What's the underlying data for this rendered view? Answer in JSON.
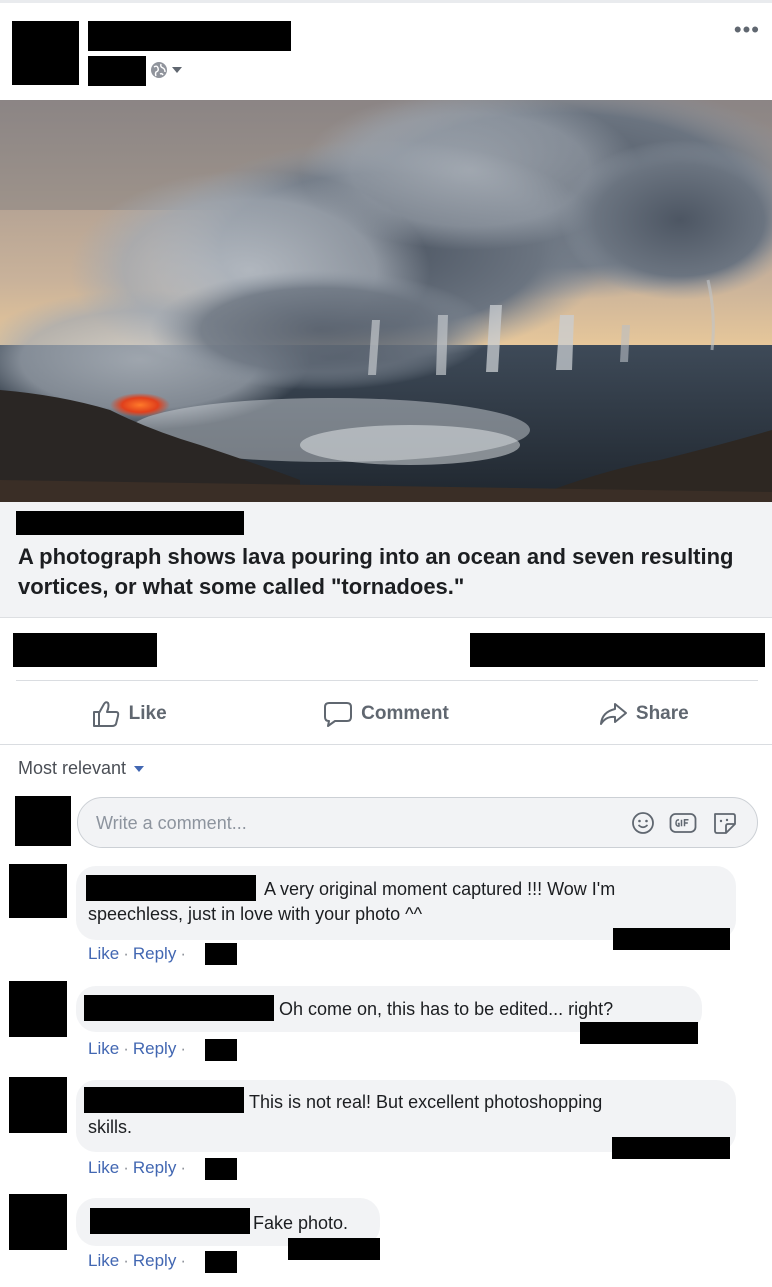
{
  "post": {
    "more_label": "•••",
    "link_title": "A photograph shows lava pouring into an ocean and seven resulting vortices, or what some called \"tornadoes.\""
  },
  "actions": {
    "like": "Like",
    "comment": "Comment",
    "share": "Share"
  },
  "comments_section": {
    "sort_label": "Most relevant",
    "input_placeholder": "Write a comment...",
    "input_value": ""
  },
  "comments": [
    {
      "line1": "A very original moment captured !!! Wow I'm",
      "line2": "speechless, just in love with your photo ^^",
      "like": "Like",
      "reply": "Reply"
    },
    {
      "line1": "Oh come on, this has to be edited... right?",
      "like": "Like",
      "reply": "Reply"
    },
    {
      "line1": "This is not real! But excellent photoshopping",
      "line2": "skills.",
      "like": "Like",
      "reply": "Reply"
    },
    {
      "line1": "Fake photo.",
      "like": "Like",
      "reply": "Reply"
    }
  ],
  "colors": {
    "link_blue": "#4267b2",
    "action_gray": "#606770",
    "bubble_bg": "#f2f3f5"
  },
  "icons": [
    "globe-icon",
    "privacy-caret-icon",
    "thumbs-up-icon",
    "comment-icon",
    "share-icon",
    "emoji-icon",
    "gif-icon",
    "sticker-icon"
  ]
}
